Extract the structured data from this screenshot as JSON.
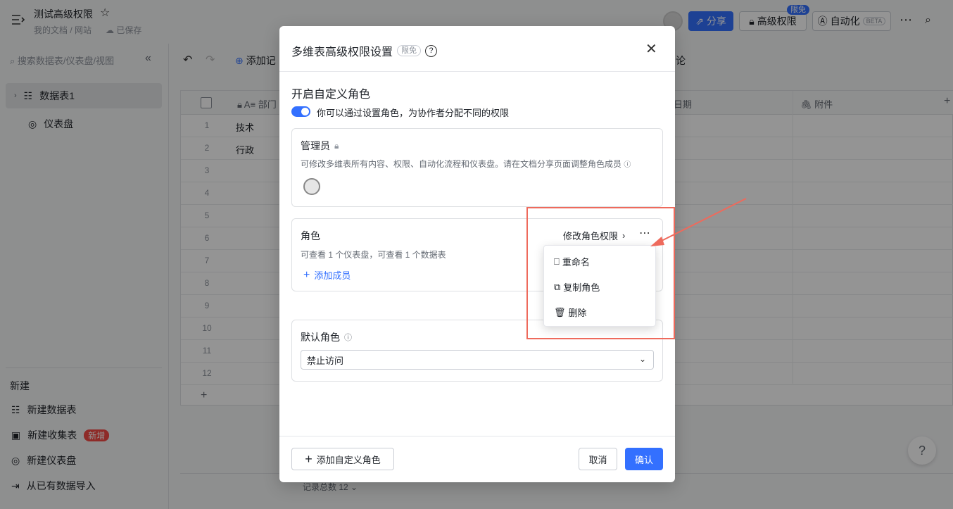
{
  "header": {
    "title": "测试高级权限",
    "breadcrumb": "我的文档 / 网站",
    "saved": "已保存",
    "share": "分享",
    "advanced_perm": "高级权限",
    "free_badge": "限免",
    "automation": "自动化",
    "beta": "BETA"
  },
  "sidebar": {
    "search_placeholder": "搜索数据表/仪表盘/视图",
    "items": [
      {
        "label": "数据表1"
      },
      {
        "label": "仪表盘"
      }
    ],
    "new_label": "新建",
    "new_items": [
      {
        "label": "新建数据表"
      },
      {
        "label": "新建收集表",
        "badge": "新增"
      },
      {
        "label": "新建仪表盘"
      },
      {
        "label": "从已有数据导入"
      }
    ]
  },
  "toolbar": {
    "add_record": "添加记",
    "comment": "论"
  },
  "grid": {
    "columns": [
      "部门",
      "日期",
      "附件"
    ],
    "rows": [
      {
        "num": "1",
        "value": "技术"
      },
      {
        "num": "2",
        "value": "行政"
      },
      {
        "num": "3",
        "value": ""
      },
      {
        "num": "4",
        "value": ""
      },
      {
        "num": "5",
        "value": ""
      },
      {
        "num": "6",
        "value": ""
      },
      {
        "num": "7",
        "value": ""
      },
      {
        "num": "8",
        "value": ""
      },
      {
        "num": "9",
        "value": ""
      },
      {
        "num": "10",
        "value": ""
      },
      {
        "num": "11",
        "value": ""
      },
      {
        "num": "12",
        "value": ""
      }
    ],
    "add_row": "+",
    "total": "记录总数 12"
  },
  "modal": {
    "title": "多维表高级权限设置",
    "badge": "限免",
    "section_title": "开启自定义角色",
    "toggle_text": "你可以通过设置角色，为协作者分配不同的权限",
    "admin": {
      "title": "管理员",
      "desc": "可修改多维表所有内容、权限、自动化流程和仪表盘。请在文档分享页面调整角色成员"
    },
    "role": {
      "title": "角色",
      "desc": "可查看 1 个仪表盘，可查看 1 个数据表",
      "edit_link": "修改角色权限",
      "add_member": "添加成员"
    },
    "default_role": {
      "title": "默认角色",
      "value": "禁止访问"
    },
    "add_custom_role": "添加自定义角色",
    "cancel": "取消",
    "confirm": "确认"
  },
  "dropdown": {
    "items": [
      {
        "label": "重命名"
      },
      {
        "label": "复制角色"
      },
      {
        "label": "删除"
      }
    ]
  }
}
